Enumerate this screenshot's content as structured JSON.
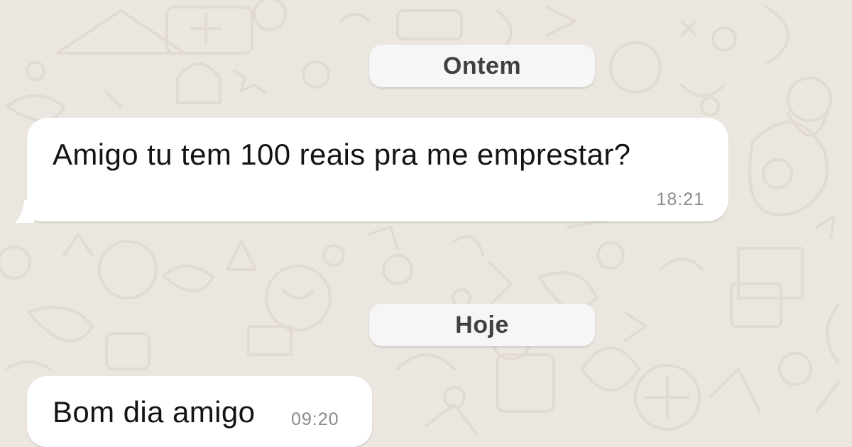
{
  "chat": {
    "background_color": "#ebe6df",
    "bubble_color": "#ffffff",
    "date_chip_color": "#f6f6f6",
    "dividers": [
      {
        "label": "Ontem"
      },
      {
        "label": "Hoje"
      }
    ],
    "messages": [
      {
        "direction": "incoming",
        "text": "Amigo tu tem 100 reais pra me emprestar?",
        "time": "18:21"
      },
      {
        "direction": "incoming",
        "text": "Bom dia amigo",
        "time": "09:20"
      }
    ]
  }
}
